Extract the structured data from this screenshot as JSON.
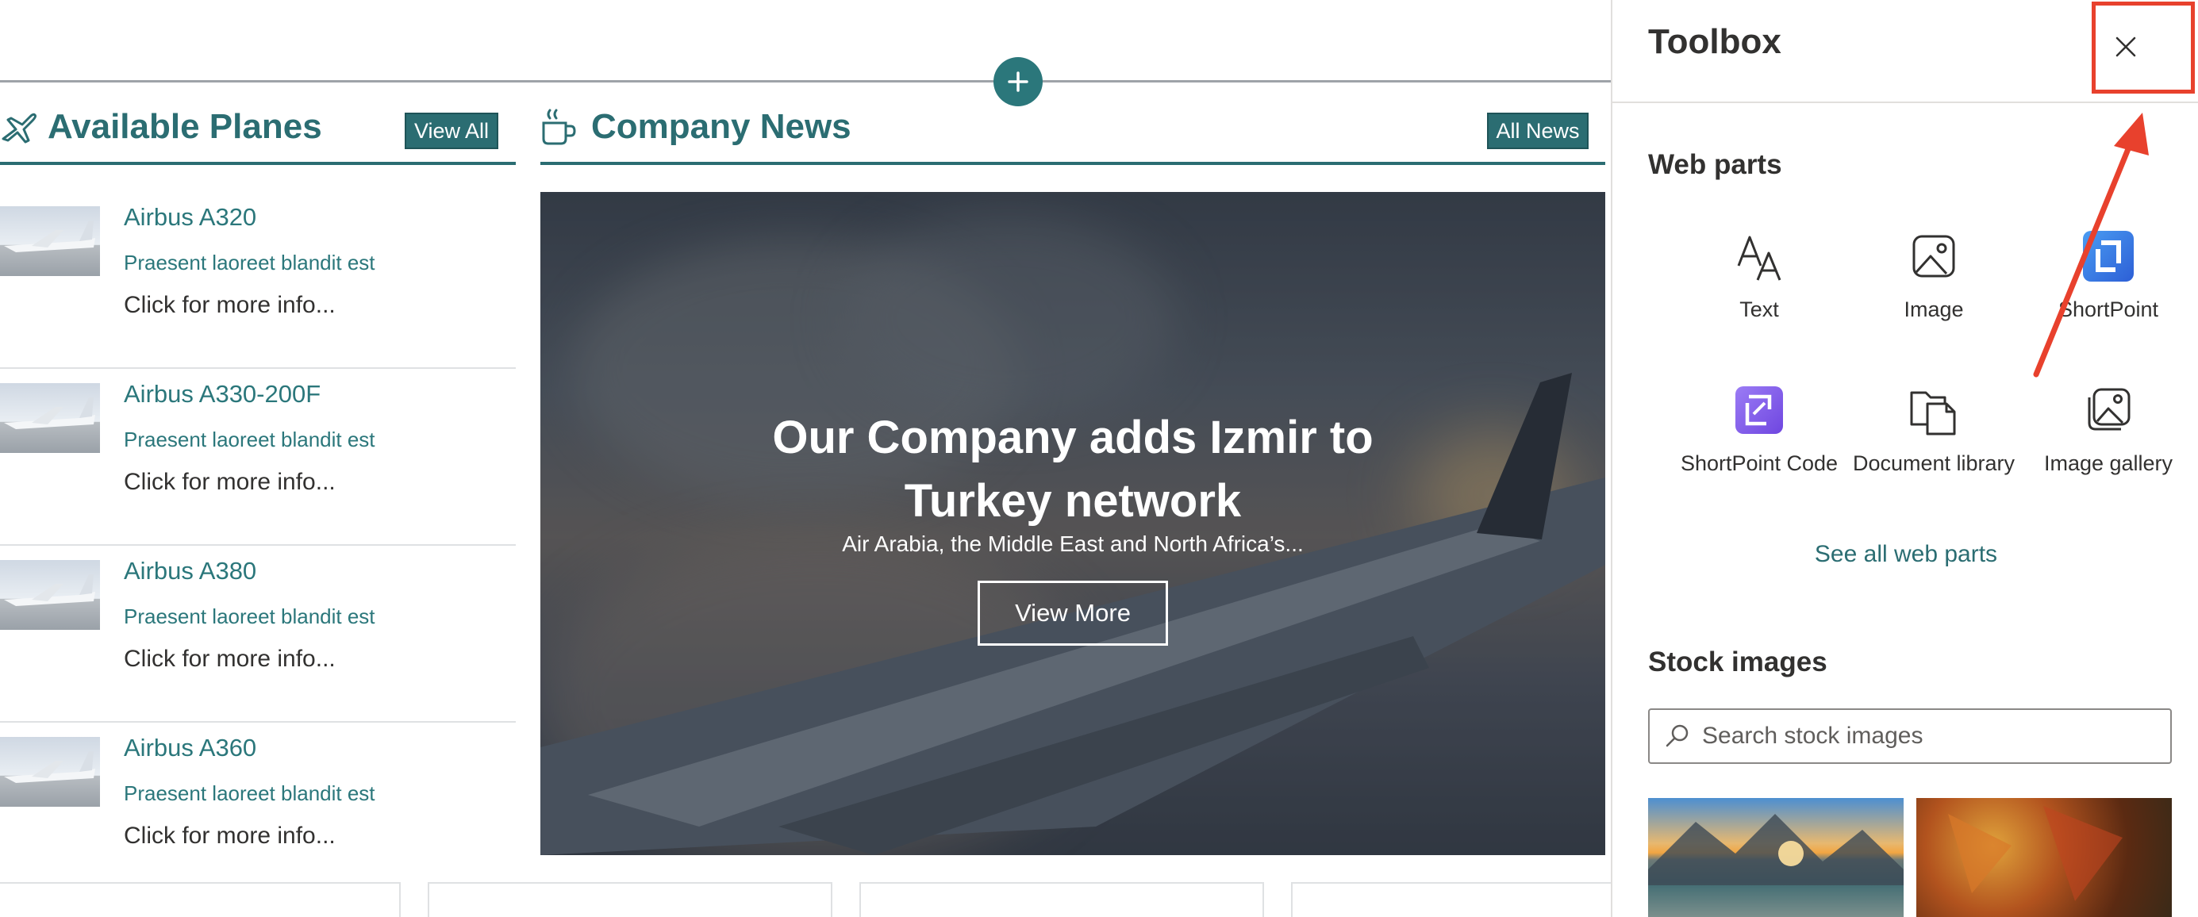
{
  "canvas": {
    "add_section_label": "+",
    "planes": {
      "title": "Available Planes",
      "view_all": "View All",
      "items": [
        {
          "name": "Airbus A320",
          "description": "Praesent laoreet blandit est",
          "more": "Click for more info..."
        },
        {
          "name": "Airbus A330-200F",
          "description": "Praesent laoreet blandit est",
          "more": "Click for more info..."
        },
        {
          "name": "Airbus A380",
          "description": "Praesent laoreet blandit est",
          "more": "Click for more info..."
        },
        {
          "name": "Airbus A360",
          "description": "Praesent laoreet blandit est",
          "more": "Click for more info..."
        }
      ]
    },
    "news": {
      "title": "Company News",
      "all_news": "All News",
      "hero": {
        "headline_line1": "Our Company adds Izmir to",
        "headline_line2": "Turkey network",
        "subtitle": "Air Arabia, the Middle East and North Africa’s...",
        "button": "View More"
      }
    }
  },
  "toolbox": {
    "title": "Toolbox",
    "close_icon": "close-icon",
    "web_parts": {
      "title": "Web parts",
      "items": [
        {
          "label": "Text",
          "icon": "text-icon"
        },
        {
          "label": "Image",
          "icon": "image-icon"
        },
        {
          "label": "ShortPoint",
          "icon": "shortpoint-icon"
        },
        {
          "label": "ShortPoint Code",
          "icon": "shortpoint-code-icon"
        },
        {
          "label": "Document library",
          "icon": "document-library-icon"
        },
        {
          "label": "Image gallery",
          "icon": "image-gallery-icon"
        }
      ],
      "see_all": "See all web parts"
    },
    "stock_images": {
      "title": "Stock images",
      "search_placeholder": "Search stock images"
    }
  },
  "colors": {
    "accent": "#2b6d72",
    "annotation": "#e8412d"
  }
}
